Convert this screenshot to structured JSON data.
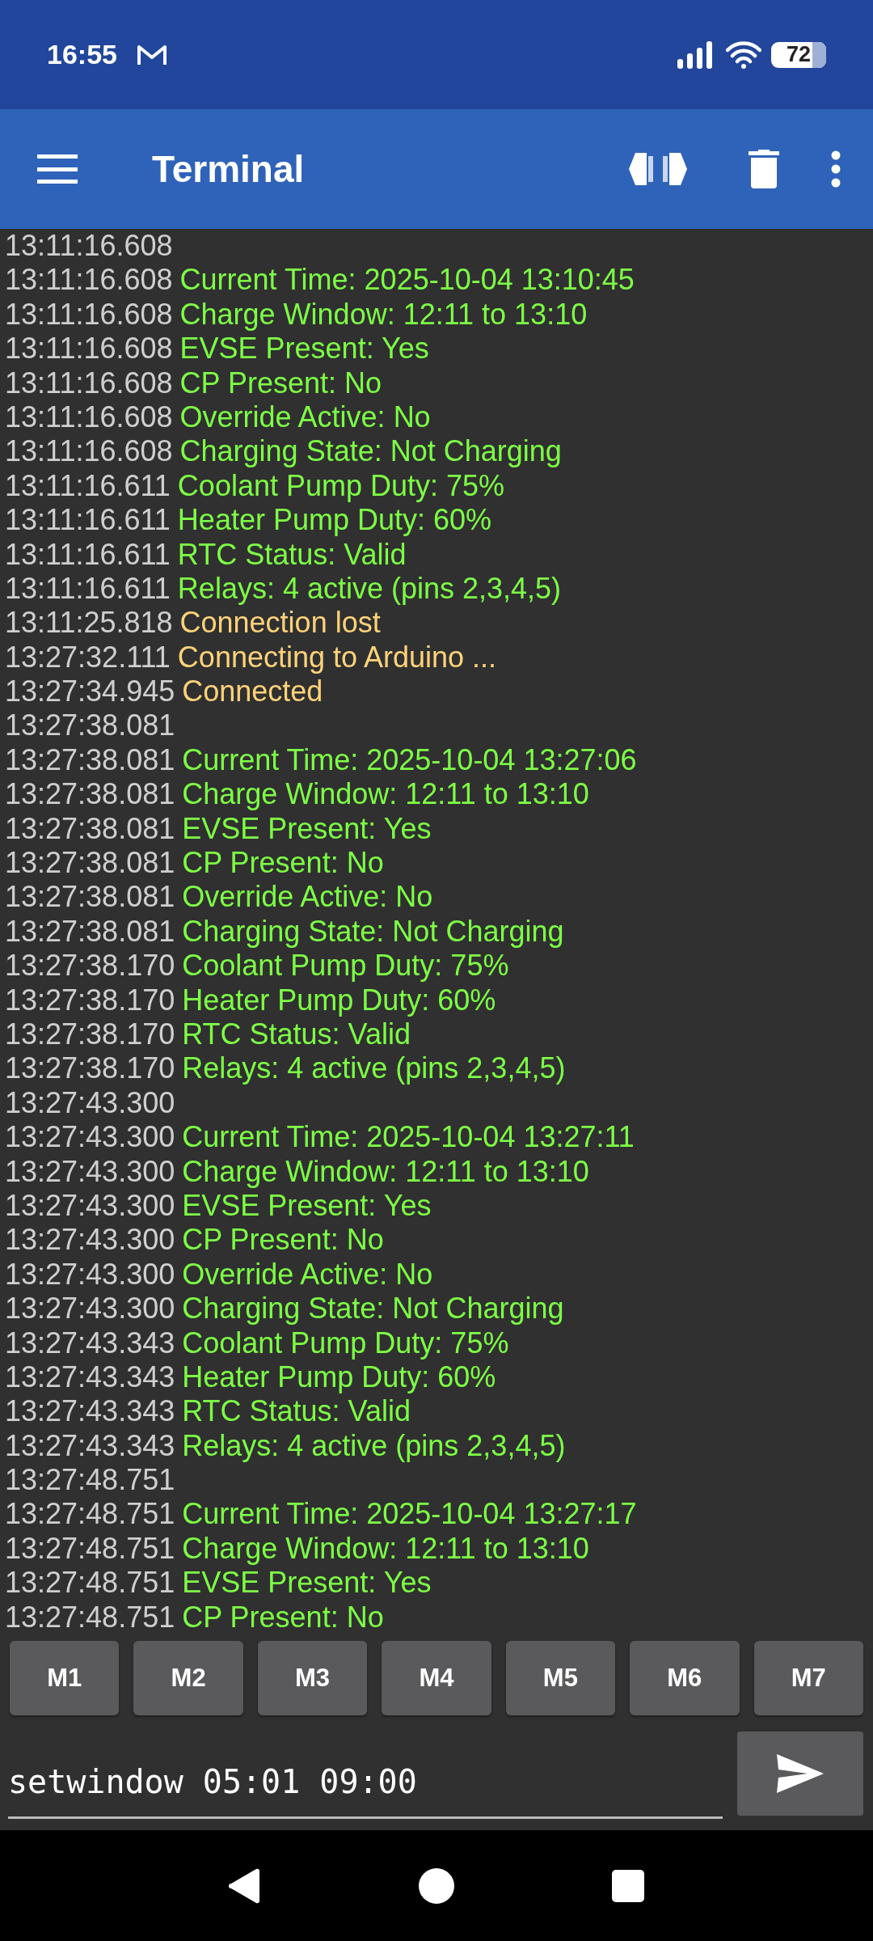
{
  "status_bar": {
    "time": "16:55",
    "battery": "72"
  },
  "app_bar": {
    "title": "Terminal"
  },
  "log": [
    {
      "time": "13:11:16.608",
      "kind": "empty"
    },
    {
      "time": "13:11:16.608",
      "kind": "data",
      "text": "Current Time: 2025-10-04 13:10:45"
    },
    {
      "time": "13:11:16.608",
      "kind": "data",
      "text": "Charge Window: 12:11 to 13:10"
    },
    {
      "time": "13:11:16.608",
      "kind": "data",
      "text": "EVSE Present: Yes"
    },
    {
      "time": "13:11:16.608",
      "kind": "data",
      "text": "CP Present: No"
    },
    {
      "time": "13:11:16.608",
      "kind": "data",
      "text": "Override Active: No"
    },
    {
      "time": "13:11:16.608",
      "kind": "data",
      "text": "Charging State: Not Charging"
    },
    {
      "time": "13:11:16.611",
      "kind": "data",
      "text": "Coolant Pump Duty: 75%"
    },
    {
      "time": "13:11:16.611",
      "kind": "data",
      "text": "Heater Pump Duty: 60%"
    },
    {
      "time": "13:11:16.611",
      "kind": "data",
      "text": "RTC Status: Valid"
    },
    {
      "time": "13:11:16.611",
      "kind": "data",
      "text": "Relays: 4 active (pins 2,3,4,5)"
    },
    {
      "time": "13:11:25.818",
      "kind": "event",
      "text": "Connection lost"
    },
    {
      "time": "13:27:32.111",
      "kind": "event",
      "text": "Connecting to Arduino ..."
    },
    {
      "time": "13:27:34.945",
      "kind": "event",
      "text": "Connected"
    },
    {
      "time": "13:27:38.081",
      "kind": "empty"
    },
    {
      "time": "13:27:38.081",
      "kind": "data",
      "text": "Current Time: 2025-10-04 13:27:06"
    },
    {
      "time": "13:27:38.081",
      "kind": "data",
      "text": "Charge Window: 12:11 to 13:10"
    },
    {
      "time": "13:27:38.081",
      "kind": "data",
      "text": "EVSE Present: Yes"
    },
    {
      "time": "13:27:38.081",
      "kind": "data",
      "text": "CP Present: No"
    },
    {
      "time": "13:27:38.081",
      "kind": "data",
      "text": "Override Active: No"
    },
    {
      "time": "13:27:38.081",
      "kind": "data",
      "text": "Charging State: Not Charging"
    },
    {
      "time": "13:27:38.170",
      "kind": "data",
      "text": "Coolant Pump Duty: 75%"
    },
    {
      "time": "13:27:38.170",
      "kind": "data",
      "text": "Heater Pump Duty: 60%"
    },
    {
      "time": "13:27:38.170",
      "kind": "data",
      "text": "RTC Status: Valid"
    },
    {
      "time": "13:27:38.170",
      "kind": "data",
      "text": "Relays: 4 active (pins 2,3,4,5)"
    },
    {
      "time": "13:27:43.300",
      "kind": "empty"
    },
    {
      "time": "13:27:43.300",
      "kind": "data",
      "text": "Current Time: 2025-10-04 13:27:11"
    },
    {
      "time": "13:27:43.300",
      "kind": "data",
      "text": "Charge Window: 12:11 to 13:10"
    },
    {
      "time": "13:27:43.300",
      "kind": "data",
      "text": "EVSE Present: Yes"
    },
    {
      "time": "13:27:43.300",
      "kind": "data",
      "text": "CP Present: No"
    },
    {
      "time": "13:27:43.300",
      "kind": "data",
      "text": "Override Active: No"
    },
    {
      "time": "13:27:43.300",
      "kind": "data",
      "text": "Charging State: Not Charging"
    },
    {
      "time": "13:27:43.343",
      "kind": "data",
      "text": "Coolant Pump Duty: 75%"
    },
    {
      "time": "13:27:43.343",
      "kind": "data",
      "text": "Heater Pump Duty: 60%"
    },
    {
      "time": "13:27:43.343",
      "kind": "data",
      "text": "RTC Status: Valid"
    },
    {
      "time": "13:27:43.343",
      "kind": "data",
      "text": "Relays: 4 active (pins 2,3,4,5)"
    },
    {
      "time": "13:27:48.751",
      "kind": "empty"
    },
    {
      "time": "13:27:48.751",
      "kind": "data",
      "text": "Current Time: 2025-10-04 13:27:17"
    },
    {
      "time": "13:27:48.751",
      "kind": "data",
      "text": "Charge Window: 12:11 to 13:10"
    },
    {
      "time": "13:27:48.751",
      "kind": "data",
      "text": "EVSE Present: Yes"
    },
    {
      "time": "13:27:48.751",
      "kind": "data",
      "text": "CP Present: No"
    }
  ],
  "macro_buttons": [
    "M1",
    "M2",
    "M3",
    "M4",
    "M5",
    "M6",
    "M7"
  ],
  "input": {
    "value": "setwindow 05:01 09:00"
  }
}
